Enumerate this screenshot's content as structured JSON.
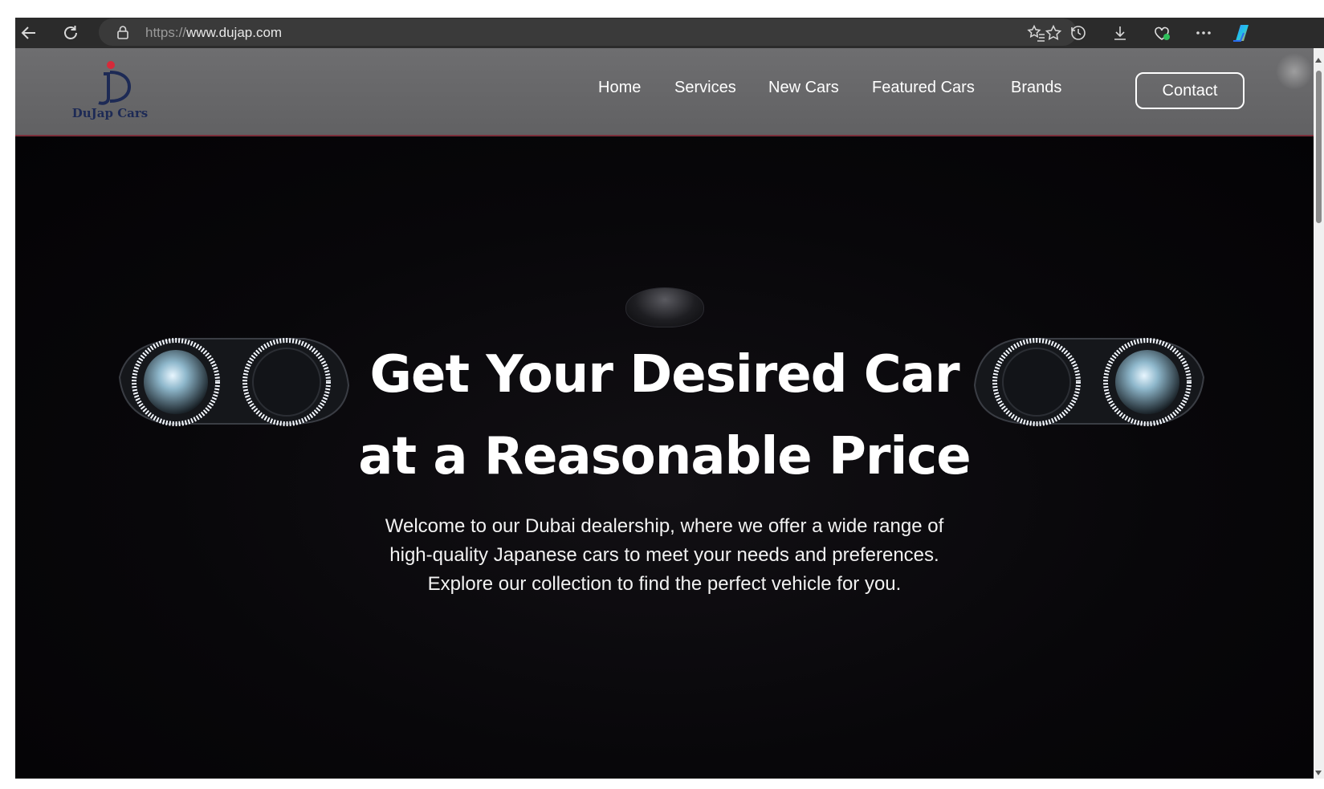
{
  "browser": {
    "url_protocol": "https://",
    "url_host": "www.dujap.com"
  },
  "icons": {
    "back": "back-arrow-icon",
    "reload": "reload-icon",
    "lock": "lock-icon",
    "favorite": "star-icon",
    "favorites_list": "favorites-icon",
    "history": "history-icon",
    "downloads": "download-icon",
    "browser_essentials": "heart-icon",
    "more": "more-icon",
    "copilot": "copilot-icon"
  },
  "site": {
    "logo_text": "DuJap Cars",
    "nav": {
      "home": "Home",
      "services": "Services",
      "new_cars": "New Cars",
      "featured_cars": "Featured Cars",
      "brands": "Brands",
      "contact": "Contact"
    }
  },
  "hero": {
    "title_line1": "Get Your Desired Car",
    "title_line2": "at a Reasonable Price",
    "text_line1": "Welcome to our Dubai dealership, where we offer a wide range of",
    "text_line2": "high-quality Japanese cars to meet your needs and preferences.",
    "text_line3": "Explore our collection to find the perfect vehicle for you."
  },
  "colors": {
    "header_bg": "#666668",
    "hero_bg": "#08070a",
    "logo_navy": "#1d2a55",
    "logo_red": "#d62a3a"
  }
}
